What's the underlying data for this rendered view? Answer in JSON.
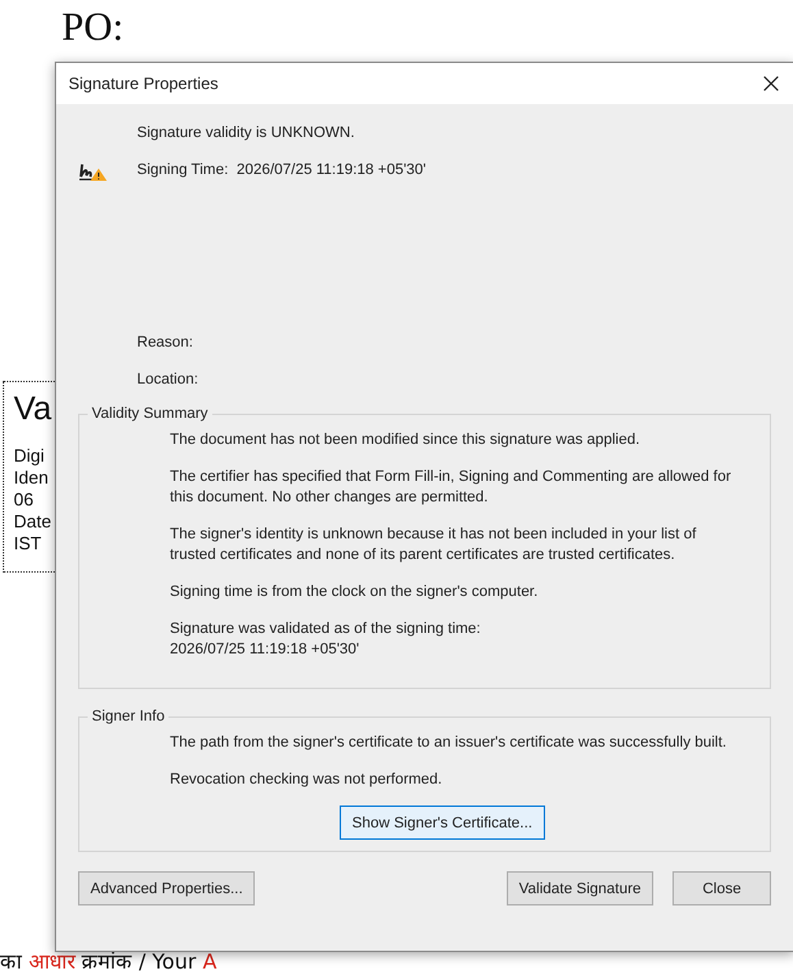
{
  "document": {
    "heading": "PO:",
    "stamp_lines": [
      "Va",
      "Digi",
      "Iden",
      "06",
      "Date",
      "IST"
    ],
    "footer_segments": [
      {
        "text": "का ",
        "color": "#111111"
      },
      {
        "text": "आधार",
        "color": "#d9261c"
      },
      {
        "text": " क्रमांक / Your ",
        "color": "#111111"
      },
      {
        "text": "A",
        "color": "#d9261c"
      }
    ]
  },
  "dialog": {
    "title": "Signature Properties",
    "status_lines": [
      "Signature validity is UNKNOWN.",
      "Signing Time:  2026/07/25 11:19:18 +05'30'"
    ],
    "fields": [
      "Reason:",
      "Location:"
    ],
    "groups": [
      {
        "title": "Validity Summary",
        "paragraphs": [
          {
            "lines": [
              "The document has not been modified since this signature was applied."
            ]
          },
          {
            "lines": [
              "The certifier has specified that Form Fill-in, Signing and Commenting are allowed for",
              "this document. No other changes are permitted."
            ]
          },
          {
            "lines": [
              "The signer's identity is unknown because it has not been included in your list of",
              "trusted certificates and none of its parent certificates are trusted certificates."
            ]
          },
          {
            "lines": [
              "Signing time is from the clock on the signer's computer."
            ]
          },
          {
            "lines": [
              "Signature was validated as of the signing time:",
              "2026/07/25 11:19:18 +05'30'"
            ]
          }
        ]
      },
      {
        "title": "Signer Info",
        "paragraphs": [
          {
            "lines": [
              "The path from the signer's certificate to an issuer's certificate was successfully built."
            ]
          },
          {
            "lines": [
              "Revocation checking was not performed."
            ]
          }
        ],
        "button": "Show Signer's Certificate..."
      }
    ],
    "buttons": [
      {
        "label": "Advanced Properties...",
        "kind": "left"
      },
      {
        "label": "Validate Signature",
        "kind": "right"
      },
      {
        "label": "Close",
        "kind": "right"
      }
    ]
  }
}
